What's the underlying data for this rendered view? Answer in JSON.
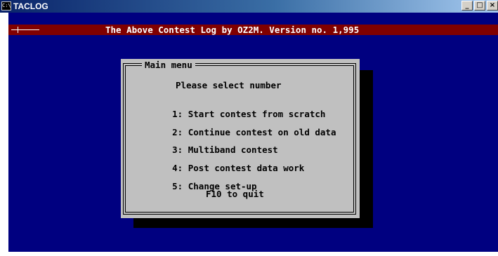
{
  "window": {
    "title": "TACLOG",
    "app_icon_glyph": "C:\\",
    "controls": {
      "minimize": "_",
      "maximize": "□",
      "close": "×"
    }
  },
  "status_bar": {
    "header": "The Above Contest Log by OZ2M. Version no. 1,995",
    "bar_color": "#800000",
    "text_color": "#ffffff"
  },
  "console": {
    "background_color": "#000080"
  },
  "main_menu": {
    "title": "Main menu",
    "prompt": "Please select number",
    "items": [
      {
        "key": "1:",
        "label": "Start contest from scratch"
      },
      {
        "key": "2:",
        "label": "Continue contest on old data"
      },
      {
        "key": "3:",
        "label": "Multiband contest"
      },
      {
        "key": "4:",
        "label": "Post contest data work"
      },
      {
        "key": "5:",
        "label": "Change set-up"
      }
    ],
    "quit_hint": "F10 to quit",
    "background_color": "#c0c0c0",
    "shadow_color": "#000000"
  }
}
